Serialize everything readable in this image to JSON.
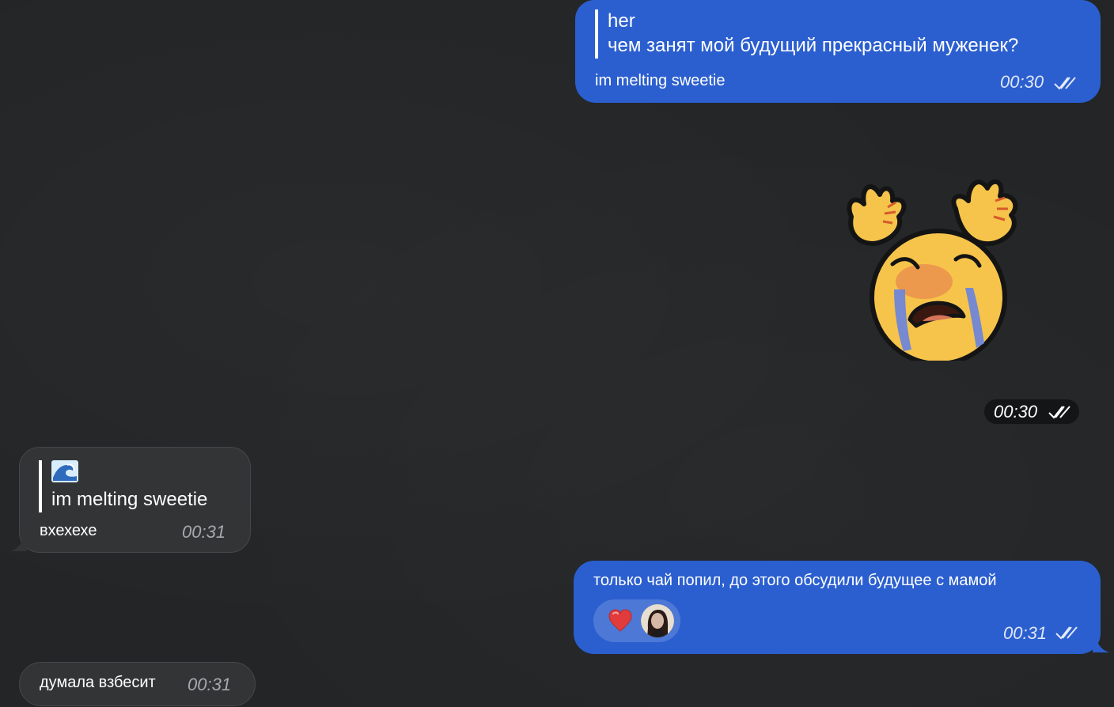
{
  "messages": {
    "m1": {
      "quote_title": "her",
      "quote_text": "чем занят мой будущий прекрасный муженек?",
      "text": "im melting sweetie",
      "time": "00:30"
    },
    "sticker": {
      "time": "00:30"
    },
    "m2": {
      "quote_text": "im melting sweetie",
      "text": "вхехехе",
      "time": "00:31"
    },
    "m3": {
      "text": "только чай попил, до этого обсудили будущее с мамой",
      "time": "00:31",
      "reactions": [
        "heart-icon",
        "avatar"
      ]
    },
    "m4": {
      "text": "думала взбесит",
      "time": "00:31"
    }
  },
  "colors": {
    "outgoing_bubble": "#2b5fcf",
    "incoming_bubble": "#333436",
    "background": "#232527"
  }
}
